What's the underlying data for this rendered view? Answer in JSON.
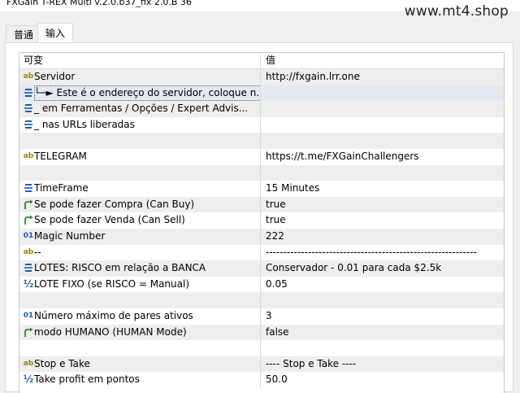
{
  "window": {
    "title": "FXGain T-REX Multi v.2.0.b37_fix 2.0.B 36"
  },
  "watermark": "www.mt4.shop",
  "tabs": [
    {
      "label": "普通",
      "active": false
    },
    {
      "label": "输入",
      "active": true
    }
  ],
  "grid": {
    "col_variable": "可变",
    "col_value": "值",
    "rows": [
      {
        "icon": "ab",
        "label": "Servidor",
        "value": "http://fxgain.lrr.one"
      },
      {
        "icon": "enum",
        "label": "└─►  Este é o endereço do servidor, coloque n...",
        "value": ""
      },
      {
        "icon": "enum",
        "label": "_        em Ferramentas / Opções / Expert Advis...",
        "value": ""
      },
      {
        "icon": "enum",
        "label": "_        nas URLs liberadas",
        "value": ""
      },
      {
        "icon": "",
        "label": "",
        "value": ""
      },
      {
        "icon": "ab",
        "label": "TELEGRAM",
        "value": "https://t.me/FXGainChallengers"
      },
      {
        "icon": "",
        "label": "",
        "value": ""
      },
      {
        "icon": "enum",
        "label": "TimeFrame",
        "value": "15 Minutes"
      },
      {
        "icon": "bool",
        "label": "Se pode fazer Compra (Can Buy)",
        "value": "true"
      },
      {
        "icon": "bool",
        "label": "Se pode fazer Venda (Can Sell)",
        "value": "true"
      },
      {
        "icon": "int",
        "label": "Magic Number",
        "value": "222"
      },
      {
        "icon": "ab",
        "label": "--",
        "value": "------------------------------------------------------------"
      },
      {
        "icon": "enum",
        "label": "LOTES: RISCO em relação a BANCA",
        "value": "Conservador - 0.01 para cada $2.5k"
      },
      {
        "icon": "double",
        "label": "LOTE FIXO (se RISCO = Manual)",
        "value": "0.05"
      },
      {
        "icon": "",
        "label": "",
        "value": ""
      },
      {
        "icon": "int",
        "label": "Número máximo de pares ativos",
        "value": "3"
      },
      {
        "icon": "bool",
        "label": "modo HUMANO (HUMAN Mode)",
        "value": "false"
      },
      {
        "icon": "",
        "label": "",
        "value": ""
      },
      {
        "icon": "ab",
        "label": "Stop e Take",
        "value": "---- Stop e Take ----"
      },
      {
        "icon": "double",
        "label": "Take profit em pontos",
        "value": "50.0"
      }
    ]
  }
}
